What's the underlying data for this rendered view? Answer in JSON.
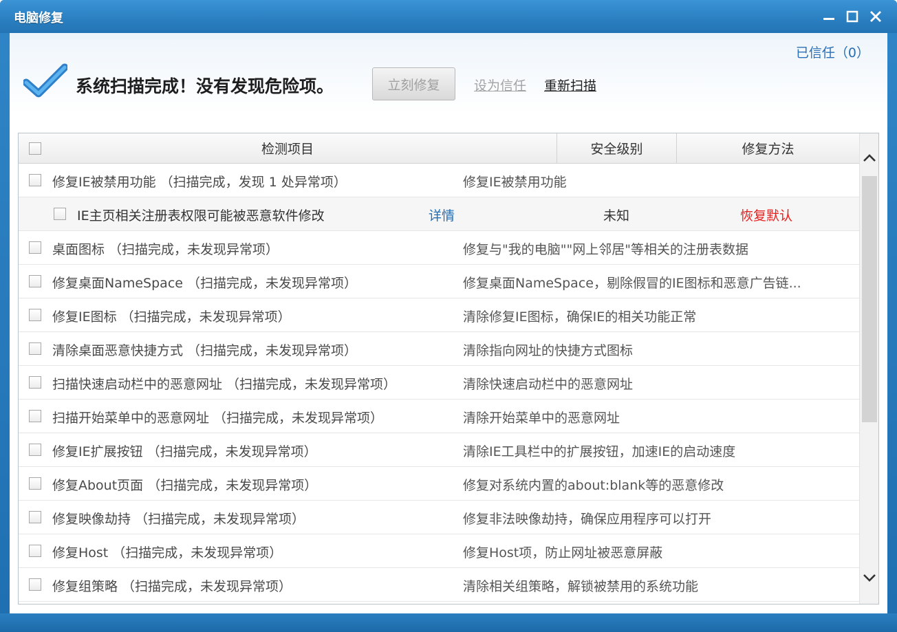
{
  "window": {
    "title": "电脑修复"
  },
  "header": {
    "trusted": "已信任（0）",
    "status": "系统扫描完成！没有发现危险项。",
    "fix_button": "立刻修复",
    "trust_link": "设为信任",
    "rescan_link": "重新扫描"
  },
  "table": {
    "columns": {
      "item": "检测项目",
      "level": "安全级别",
      "fix": "修复方法"
    },
    "group": {
      "name": "修复IE被禁用功能   （扫描完成，发现 1 处异常项）",
      "desc": "修复IE被禁用功能"
    },
    "subitem": {
      "name": "IE主页相关注册表权限可能被恶意软件修改",
      "detail": "详情",
      "level": "未知",
      "action": "恢复默认"
    },
    "rows": [
      {
        "name": "桌面图标   （扫描完成，未发现异常项）",
        "desc": "修复与\"我的电脑\"\"网上邻居\"等相关的注册表数据"
      },
      {
        "name": "修复桌面NameSpace   （扫描完成，未发现异常项）",
        "desc": "修复桌面NameSpace，剔除假冒的IE图标和恶意广告链..."
      },
      {
        "name": "修复IE图标   （扫描完成，未发现异常项）",
        "desc": "清除修复IE图标，确保IE的相关功能正常"
      },
      {
        "name": "清除桌面恶意快捷方式   （扫描完成，未发现异常项）",
        "desc": "清除指向网址的快捷方式图标"
      },
      {
        "name": "扫描快速启动栏中的恶意网址   （扫描完成，未发现异常项）",
        "desc": "清除快速启动栏中的恶意网址"
      },
      {
        "name": "扫描开始菜单中的恶意网址   （扫描完成，未发现异常项）",
        "desc": "清除开始菜单中的恶意网址"
      },
      {
        "name": "修复IE扩展按钮   （扫描完成，未发现异常项）",
        "desc": "清除IE工具栏中的扩展按钮，加速IE的启动速度"
      },
      {
        "name": "修复About页面   （扫描完成，未发现异常项）",
        "desc": "修复对系统内置的about:blank等的恶意修改"
      },
      {
        "name": "修复映像劫持   （扫描完成，未发现异常项）",
        "desc": "修复非法映像劫持，确保应用程序可以打开"
      },
      {
        "name": "修复Host   （扫描完成，未发现异常项）",
        "desc": "修复Host项，防止网址被恶意屏蔽"
      },
      {
        "name": "修复组策略   （扫描完成，未发现异常项）",
        "desc": "清除相关组策略，解锁被禁用的系统功能"
      }
    ]
  },
  "colors": {
    "titlebar": "#2a7fc0",
    "link": "#1f6fb8",
    "danger": "#e8201e",
    "check": "#3a98e0"
  },
  "icons": {
    "minimize": "minimize-icon",
    "maximize": "maximize-icon",
    "close": "close-icon",
    "status": "checkmark-icon",
    "scroll_up": "chevron-up-icon",
    "scroll_down": "chevron-down-icon"
  }
}
